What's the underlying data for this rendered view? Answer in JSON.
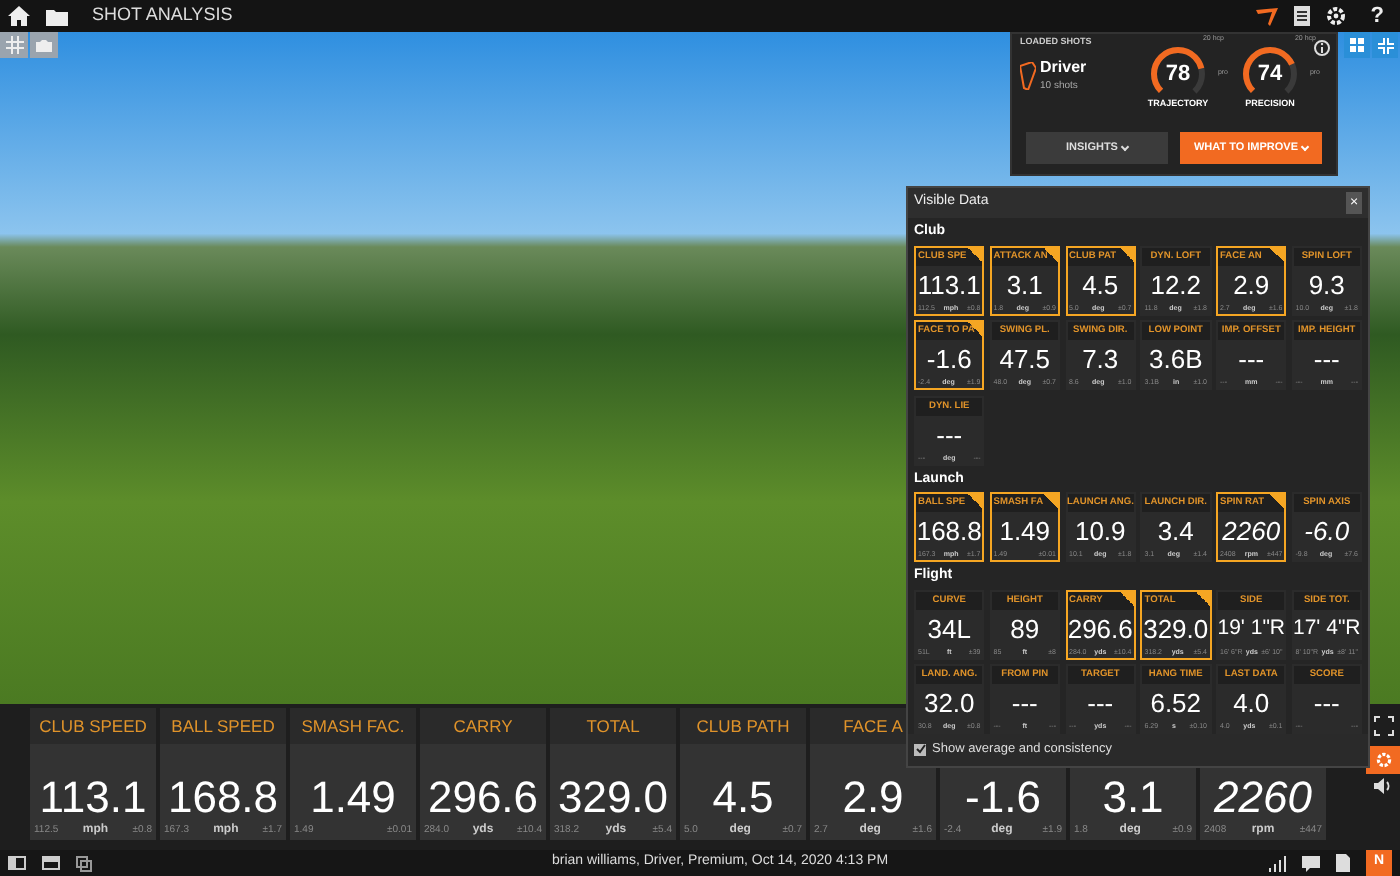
{
  "top_bar": {
    "title": "SHOT ANALYSIS",
    "help": "?"
  },
  "loaded_shots": {
    "label": "LOADED SHOTS",
    "club": "Driver",
    "shots": "10 shots",
    "gauges": [
      {
        "value": "78",
        "label": "TRAJECTORY",
        "level": 0.78,
        "low": "20 hcp",
        "high": "pro"
      },
      {
        "value": "74",
        "label": "PRECISION",
        "level": 0.74,
        "low": "20 hcp",
        "high": "pro"
      }
    ],
    "buttons": [
      {
        "label": "INSIGHTS",
        "kind": "secondary"
      },
      {
        "label": "WHAT TO IMPROVE",
        "kind": "primary"
      }
    ]
  },
  "visible_data": {
    "title": "Visible Data",
    "close": "×",
    "sections": [
      {
        "title": "Club",
        "tiles": [
          {
            "label": "CLUB SPE",
            "value": "113.1",
            "unit": "mph",
            "avg": "112.5",
            "consistency": "±0.8",
            "selected": true,
            "italic": false
          },
          {
            "label": "ATTACK AN",
            "value": "3.1",
            "unit": "deg",
            "avg": "1.8",
            "consistency": "±0.9",
            "selected": true,
            "italic": false
          },
          {
            "label": "CLUB PAT",
            "value": "4.5",
            "unit": "deg",
            "avg": "5.0",
            "consistency": "±0.7",
            "selected": true,
            "italic": false
          },
          {
            "label": "DYN. LOFT",
            "value": "12.2",
            "unit": "deg",
            "avg": "11.8",
            "consistency": "±1.8",
            "selected": false,
            "italic": false
          },
          {
            "label": "FACE AN",
            "value": "2.9",
            "unit": "deg",
            "avg": "2.7",
            "consistency": "±1.6",
            "selected": true,
            "italic": false
          },
          {
            "label": "SPIN LOFT",
            "value": "9.3",
            "unit": "deg",
            "avg": "10.0",
            "consistency": "±1.8",
            "selected": false,
            "italic": false
          },
          {
            "label": "FACE TO PA",
            "value": "-1.6",
            "unit": "deg",
            "avg": "-2.4",
            "consistency": "±1.9",
            "selected": true,
            "italic": false
          },
          {
            "label": "SWING PL.",
            "value": "47.5",
            "unit": "deg",
            "avg": "48.0",
            "consistency": "±0.7",
            "selected": false,
            "italic": false
          },
          {
            "label": "SWING DIR.",
            "value": "7.3",
            "unit": "deg",
            "avg": "8.6",
            "consistency": "±1.0",
            "selected": false,
            "italic": false
          },
          {
            "label": "LOW POINT",
            "value": "3.6B",
            "unit": "in",
            "avg": "3.1B",
            "consistency": "±1.0",
            "selected": false,
            "italic": false
          },
          {
            "label": "IMP. OFFSET",
            "value": "---",
            "unit": "mm",
            "avg": "---",
            "consistency": "---",
            "selected": false,
            "italic": false
          },
          {
            "label": "IMP. HEIGHT",
            "value": "---",
            "unit": "mm",
            "avg": "---",
            "consistency": "---",
            "selected": false,
            "italic": false
          },
          {
            "label": "DYN. LIE",
            "value": "---",
            "unit": "deg",
            "avg": "---",
            "consistency": "---",
            "selected": false,
            "italic": false
          }
        ]
      },
      {
        "title": "Launch",
        "tiles": [
          {
            "label": "BALL SPE",
            "value": "168.8",
            "unit": "mph",
            "avg": "167.3",
            "consistency": "±1.7",
            "selected": true,
            "italic": false
          },
          {
            "label": "SMASH FA",
            "value": "1.49",
            "avg": "1.49",
            "consistency": "±0.01",
            "selected": true,
            "italic": false
          },
          {
            "label": "LAUNCH ANG.",
            "value": "10.9",
            "unit": "deg",
            "avg": "10.1",
            "consistency": "±1.8",
            "selected": false,
            "italic": false
          },
          {
            "label": "LAUNCH DIR.",
            "value": "3.4",
            "unit": "deg",
            "avg": "3.1",
            "consistency": "±1.4",
            "selected": false,
            "italic": false
          },
          {
            "label": "SPIN RAT",
            "value": "2260",
            "unit": "rpm",
            "avg": "2408",
            "consistency": "±447",
            "selected": true,
            "italic": true
          },
          {
            "label": "SPIN AXIS",
            "value": "-6.0",
            "unit": "deg",
            "avg": "-9.8",
            "consistency": "±7.6",
            "selected": false,
            "italic": true
          }
        ]
      },
      {
        "title": "Flight",
        "tiles": [
          {
            "label": "CURVE",
            "value": "34L",
            "unit": "ft",
            "avg": "51L",
            "consistency": "±39",
            "selected": false,
            "italic": false
          },
          {
            "label": "HEIGHT",
            "value": "89",
            "unit": "ft",
            "avg": "85",
            "consistency": "±8",
            "selected": false,
            "italic": false
          },
          {
            "label": "CARRY",
            "value": "296.6",
            "unit": "yds",
            "avg": "284.0",
            "consistency": "±10.4",
            "selected": true,
            "italic": false
          },
          {
            "label": "TOTAL",
            "value": "329.0",
            "unit": "yds",
            "avg": "318.2",
            "consistency": "±5.4",
            "selected": true,
            "italic": false
          },
          {
            "label": "SIDE",
            "value": "19' 1\"R",
            "unit": "yds",
            "avg": "16' 6\"R",
            "consistency": "±6' 10\"",
            "selected": false,
            "italic": false
          },
          {
            "label": "SIDE TOT.",
            "value": "17' 4\"R",
            "unit": "yds",
            "avg": "8' 10\"R",
            "consistency": "±8' 11\"",
            "selected": false,
            "italic": false
          },
          {
            "label": "LAND. ANG.",
            "value": "32.0",
            "unit": "deg",
            "avg": "30.8",
            "consistency": "±0.8",
            "selected": false,
            "italic": false
          },
          {
            "label": "FROM PIN",
            "value": "---",
            "unit": "ft",
            "avg": "---",
            "consistency": "---",
            "selected": false,
            "italic": false
          },
          {
            "label": "TARGET",
            "value": "---",
            "unit": "yds",
            "avg": "---",
            "consistency": "---",
            "selected": false,
            "italic": false
          },
          {
            "label": "HANG TIME",
            "value": "6.52",
            "unit": "s",
            "avg": "6.29",
            "consistency": "±0.10",
            "selected": false,
            "italic": false
          },
          {
            "label": "LAST DATA",
            "value": "4.0",
            "unit": "yds",
            "avg": "4.0",
            "consistency": "±0.1",
            "selected": false,
            "italic": false
          },
          {
            "label": "SCORE",
            "value": "---",
            "avg": "---",
            "consistency": "---",
            "selected": false,
            "italic": false
          }
        ]
      }
    ],
    "show_average": {
      "label": "Show average and consistency",
      "checked": true
    }
  },
  "bottom_tiles": [
    {
      "label": "CLUB SPEED",
      "value": "113.1",
      "unit": "mph",
      "avg": "112.5",
      "consistency": "±0.8",
      "italic": false
    },
    {
      "label": "BALL SPEED",
      "value": "168.8",
      "unit": "mph",
      "avg": "167.3",
      "consistency": "±1.7",
      "italic": false
    },
    {
      "label": "SMASH FAC.",
      "value": "1.49",
      "avg": "1.49",
      "consistency": "±0.01",
      "italic": false
    },
    {
      "label": "CARRY",
      "value": "296.6",
      "unit": "yds",
      "avg": "284.0",
      "consistency": "±10.4",
      "italic": false
    },
    {
      "label": "TOTAL",
      "value": "329.0",
      "unit": "yds",
      "avg": "318.2",
      "consistency": "±5.4",
      "italic": false
    },
    {
      "label": "CLUB PATH",
      "value": "4.5",
      "unit": "deg",
      "avg": "5.0",
      "consistency": "±0.7",
      "italic": false
    },
    {
      "label": "FACE A",
      "value": "2.9",
      "unit": "deg",
      "avg": "2.7",
      "consistency": "±1.6",
      "italic": false
    },
    {
      "value": "-1.6",
      "unit": "deg",
      "avg": "-2.4",
      "consistency": "±1.9",
      "italic": false
    },
    {
      "value": "3.1",
      "unit": "deg",
      "avg": "1.8",
      "consistency": "±0.9",
      "italic": false
    },
    {
      "value": "2260",
      "unit": "rpm",
      "avg": "2408",
      "consistency": "±447",
      "italic": true
    }
  ],
  "status_bar": {
    "text": "brian williams, Driver, Premium, Oct 14, 2020 4:13 PM",
    "badge": "N"
  }
}
